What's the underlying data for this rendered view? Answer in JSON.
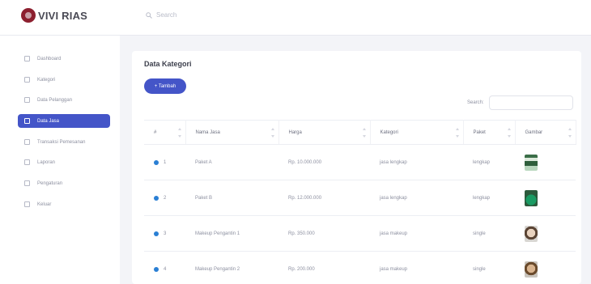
{
  "brand": {
    "name": "VIVI RIAS"
  },
  "search": {
    "placeholder": "Search"
  },
  "sidebar": {
    "items": [
      {
        "label": "Dashboard",
        "icon": "grid-icon",
        "active": false
      },
      {
        "label": "Kategori",
        "icon": "list-icon",
        "active": false
      },
      {
        "label": "Data Pelanggan",
        "icon": "user-icon",
        "active": false
      },
      {
        "label": "Data Jasa",
        "icon": "box-icon",
        "active": true
      },
      {
        "label": "Transaksi Pemesanan",
        "icon": "cart-icon",
        "active": false
      },
      {
        "label": "Laporan",
        "icon": "report-icon",
        "active": false
      },
      {
        "label": "Pengaturan",
        "icon": "gear-icon",
        "active": false
      },
      {
        "label": "Keluar",
        "icon": "logout-icon",
        "active": false
      }
    ]
  },
  "main": {
    "title": "Data Kategori",
    "add_button": "+ Tambah",
    "search_label": "Search:",
    "columns": [
      "#",
      "Nama Jasa",
      "Harga",
      "Kategori",
      "Paket",
      "Gambar"
    ],
    "rows": [
      {
        "no": "1",
        "nama": "Paket A",
        "harga": "Rp. 10.000.000",
        "kategori": "jasa lengkap",
        "paket": "lengkap",
        "gambar": "dress-green-white"
      },
      {
        "no": "2",
        "nama": "Paket B",
        "harga": "Rp. 12.000.000",
        "kategori": "jasa lengkap",
        "paket": "lengkap",
        "gambar": "dress-green"
      },
      {
        "no": "3",
        "nama": "Makeup Pengantin 1",
        "harga": "Rp. 350.000",
        "kategori": "jasa makeup",
        "paket": "single",
        "gambar": "face-1"
      },
      {
        "no": "4",
        "nama": "Makeup Pengantin 2",
        "harga": "Rp. 200.000",
        "kategori": "jasa makeup",
        "paket": "single",
        "gambar": "face-2"
      }
    ]
  },
  "colors": {
    "accent": "#4455c8",
    "brand": "#8c1f2f",
    "row_dot": "#2a7fd4"
  }
}
